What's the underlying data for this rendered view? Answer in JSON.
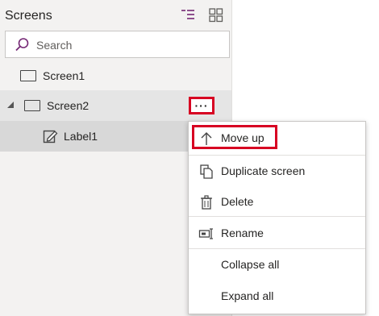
{
  "panel": {
    "title": "Screens",
    "icons": {
      "tree_view": "tree-view-icon",
      "grid_view": "grid-view-icon"
    },
    "search": {
      "placeholder": "Search",
      "icon": "search-icon"
    }
  },
  "tree": [
    {
      "label": "Screen1",
      "icon": "screen-icon"
    },
    {
      "label": "Screen2",
      "icon": "screen-icon",
      "expanded": true,
      "more": "···"
    },
    {
      "label": "Label1",
      "icon": "edit-label-icon"
    }
  ],
  "context_menu": {
    "items": [
      {
        "label": "Move up",
        "icon": "arrow-up-icon"
      },
      {
        "label": "Duplicate screen",
        "icon": "duplicate-icon"
      },
      {
        "label": "Delete",
        "icon": "trash-icon"
      },
      {
        "label": "Rename",
        "icon": "rename-icon"
      },
      {
        "label": "Collapse all",
        "icon": ""
      },
      {
        "label": "Expand all",
        "icon": ""
      }
    ]
  },
  "colors": {
    "highlight_border": "#d70022",
    "panel_bg": "#f3f2f1",
    "accent": "#742774"
  }
}
